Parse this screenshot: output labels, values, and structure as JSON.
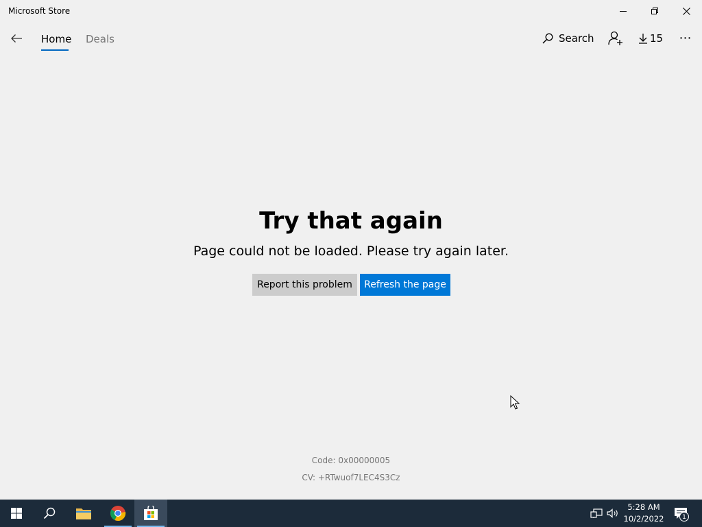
{
  "window": {
    "title": "Microsoft Store",
    "controls": [
      "minimize-icon",
      "restore-icon",
      "close-icon"
    ]
  },
  "nav": {
    "tabs": [
      {
        "label": "Home",
        "selected": true
      },
      {
        "label": "Deals",
        "selected": false
      }
    ],
    "search_label": "Search",
    "downloads_count": "15",
    "accent_color": "#0067c0"
  },
  "error": {
    "heading": "Try that again",
    "message": "Page could not be loaded. Please try again later.",
    "report_button": "Report this problem",
    "refresh_button": "Refresh the page",
    "code": "Code: 0x00000005",
    "cv": "CV: +RTwuof7LEC4S3Cz"
  },
  "taskbar": {
    "pinned_apps": [
      "start-icon",
      "search-icon",
      "file-explorer-icon",
      "chrome-icon",
      "microsoft-store-icon"
    ],
    "active_app": "microsoft-store-icon",
    "clock": {
      "time": "5:28 AM",
      "date": "10/2/2022"
    },
    "notification_count": "1"
  }
}
